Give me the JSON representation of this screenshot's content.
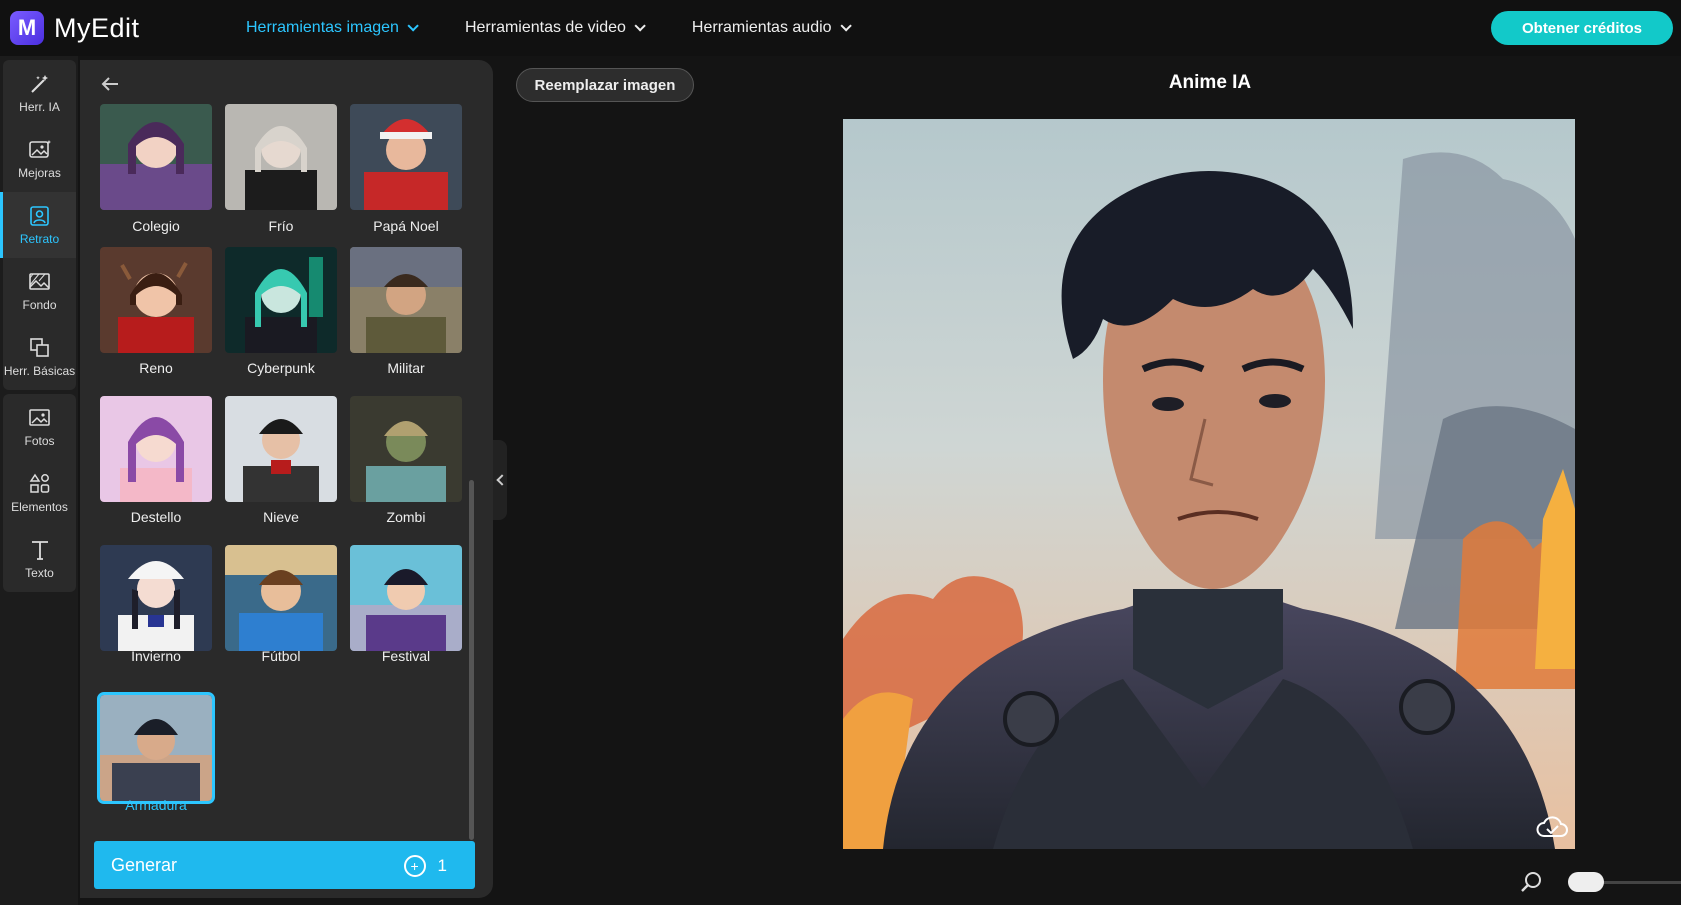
{
  "app": {
    "name": "MyEdit",
    "logo_letter": "M"
  },
  "nav": [
    {
      "label": "Herramientas imagen",
      "active": true
    },
    {
      "label": "Herramientas de video",
      "active": false
    },
    {
      "label": "Herramientas audio",
      "active": false
    }
  ],
  "credits_button": "Obtener créditos",
  "rail": [
    {
      "label": "Herr. IA",
      "icon": "magic-wand-icon"
    },
    {
      "label": "Mejoras",
      "icon": "image-enhance-icon"
    },
    {
      "label": "Retrato",
      "icon": "portrait-icon",
      "active": true
    },
    {
      "label": "Fondo",
      "icon": "background-icon"
    },
    {
      "label": "Herr. Básicas",
      "icon": "crop-icon"
    },
    {
      "label": "Fotos",
      "icon": "photo-icon"
    },
    {
      "label": "Elementos",
      "icon": "elements-icon"
    },
    {
      "label": "Texto",
      "icon": "text-icon"
    }
  ],
  "styles": [
    {
      "label": "Colegio"
    },
    {
      "label": "Frío"
    },
    {
      "label": "Papá Noel"
    },
    {
      "label": "Reno"
    },
    {
      "label": "Cyberpunk"
    },
    {
      "label": "Militar"
    },
    {
      "label": "Destello"
    },
    {
      "label": "Nieve"
    },
    {
      "label": "Zombi"
    },
    {
      "label": "Invierno"
    },
    {
      "label": "Fútbol"
    },
    {
      "label": "Festival"
    },
    {
      "label": "Armadura",
      "selected": true
    }
  ],
  "generate": {
    "label": "Generar",
    "credits": "1"
  },
  "replace_button": "Reemplazar imagen",
  "canvas_title": "Anime IA",
  "colors": {
    "accent": "#2cc6ff",
    "credits": "#12c9c9",
    "generate": "#1fb9ee"
  }
}
